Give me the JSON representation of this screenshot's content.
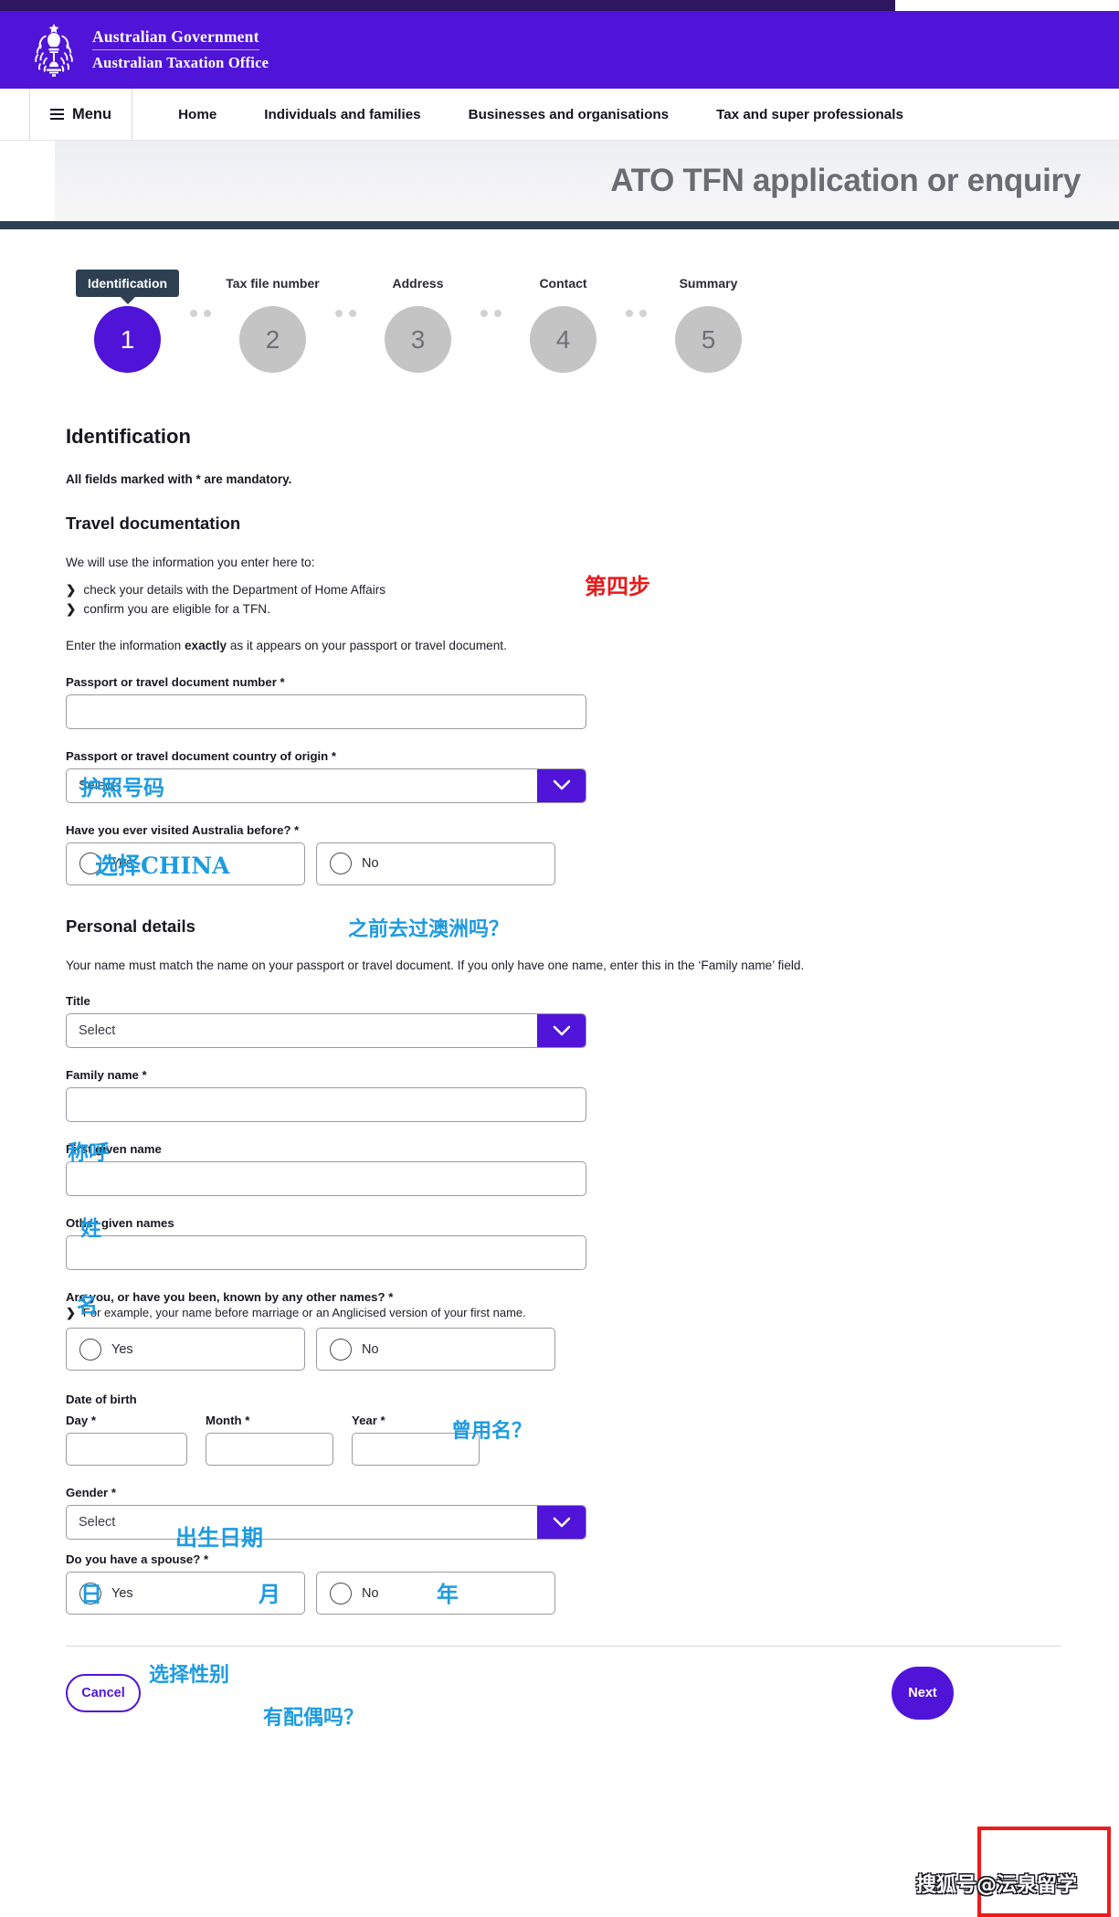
{
  "colors": {
    "brand_purple": "#5014D8",
    "top_strip_dark": "#2E1760",
    "navy_rule": "#2E3F52",
    "step_inactive_gray": "#C4C4C4",
    "annotation_blue": "#1E9BE0",
    "annotation_red": "#EE1B1B"
  },
  "header": {
    "crest_icon": "australian-coat-of-arms-icon",
    "org_line1": "Australian Government",
    "org_line2": "Australian Taxation Office"
  },
  "nav": {
    "menu_label": "Menu",
    "menu_icon": "hamburger-icon",
    "links": [
      {
        "label": "Home"
      },
      {
        "label": "Individuals and families"
      },
      {
        "label": "Businesses and organisations"
      },
      {
        "label": "Tax and super professionals"
      }
    ]
  },
  "banner": {
    "title": "ATO TFN application or enquiry"
  },
  "stepper": {
    "steps": [
      {
        "label": "Identification",
        "number": "1",
        "active": true
      },
      {
        "label": "Tax file number",
        "number": "2",
        "active": false
      },
      {
        "label": "Address",
        "number": "3",
        "active": false
      },
      {
        "label": "Contact",
        "number": "4",
        "active": false
      },
      {
        "label": "Summary",
        "number": "5",
        "active": false
      }
    ]
  },
  "form": {
    "section_title": "Identification",
    "mandatory_note": "All fields marked with * are mandatory.",
    "travel": {
      "heading": "Travel documentation",
      "intro": "We will use the information you enter here to:",
      "bullets": [
        "check your details with the Department of Home Affairs",
        "confirm you are eligible for a TFN."
      ],
      "exact_note_pre": "Enter the information ",
      "exact_note_bold": "exactly",
      "exact_note_post": " as it appears on your passport or travel document.",
      "passport_number_label": "Passport or travel document number *",
      "passport_number_value": "",
      "country_label": "Passport or travel document country of origin *",
      "country_value": "Select",
      "visited_label": "Have you ever visited Australia before? *",
      "visited_yes": "Yes",
      "visited_no": "No"
    },
    "personal": {
      "heading": "Personal details",
      "intro": "Your name must match the name on your passport or travel document. If you only have one name, enter this in the ‘Family name’ field.",
      "title_label": "Title",
      "title_value": "Select",
      "family_name_label": "Family name *",
      "family_name_value": "",
      "first_given_label": "First given name",
      "first_given_value": "",
      "other_given_label": "Other given names",
      "other_given_value": "",
      "other_names_label": "Are you, or have you been, known by any other names? *",
      "other_names_hint": "For example, your name before marriage or an Anglicised version of your first name.",
      "other_names_yes": "Yes",
      "other_names_no": "No",
      "dob_label": "Date of birth",
      "dob_day_label": "Day *",
      "dob_month_label": "Month *",
      "dob_year_label": "Year *",
      "dob_day_value": "",
      "dob_month_value": "",
      "dob_year_value": "",
      "gender_label": "Gender *",
      "gender_value": "Select",
      "spouse_label": "Do you have a spouse? *",
      "spouse_yes": "Yes",
      "spouse_no": "No"
    }
  },
  "footer": {
    "cancel_label": "Cancel",
    "next_label": "Next"
  },
  "annotations": {
    "step_four": "第四步",
    "passport_number": "护照号码",
    "country_china": "选择CHINA",
    "visited_australia": "之前去过澳洲吗？",
    "title_honorific": "称呼",
    "family_name": "姓",
    "first_given_name": "名",
    "other_names": "曾用名？",
    "dob": "出生日期",
    "dob_day": "日",
    "dob_month": "月",
    "dob_year": "年",
    "gender": "选择性别",
    "spouse": "有配偶吗？"
  },
  "watermark": {
    "text": "搜狐号@沄泉留学"
  }
}
